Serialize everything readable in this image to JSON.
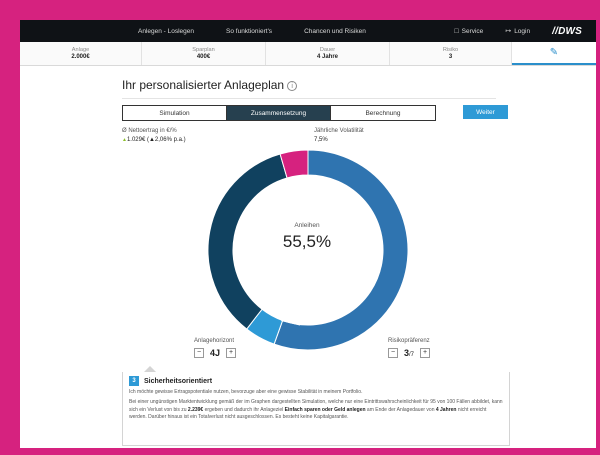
{
  "nav": {
    "items": [
      "Anlegen - Loslegen",
      "So funktioniert's",
      "Chancen und Risiken"
    ],
    "service": "Service",
    "login": "Login",
    "logo": "DWS"
  },
  "summary": [
    {
      "label": "Anlage",
      "value": "2.000€"
    },
    {
      "label": "Sparplan",
      "value": "400€"
    },
    {
      "label": "Dauer",
      "value": "4 Jahre"
    },
    {
      "label": "Risiko",
      "value": "3"
    }
  ],
  "page": {
    "title": "Ihr personalisierter Anlageplan",
    "info_glyph": "i"
  },
  "tabs": [
    {
      "label": "Simulation",
      "active": false
    },
    {
      "label": "Zusammensetzung",
      "active": true
    },
    {
      "label": "Berechnung",
      "active": false
    }
  ],
  "weiter_label": "Weiter",
  "stats": {
    "net_label": "Ø Nettoertrag in €/%",
    "net_arrow": "▲",
    "net_value": "1.029€",
    "net_pct": "(▲2,06% p.a.)",
    "vol_label": "Jährliche Volatilität",
    "vol_value": "7,5%"
  },
  "chart_data": {
    "type": "pie",
    "categories": [
      "Anleihen",
      "",
      "",
      ""
    ],
    "values": [
      55.5,
      5.0,
      35.0,
      4.5
    ],
    "colors": [
      "#2f74b0",
      "#2e9ad6",
      "#10415f",
      "#d6227f"
    ],
    "highlight": {
      "name": "Anleihen",
      "value": "55,5%"
    }
  },
  "controls": {
    "horizon_label": "Anlagehorizont",
    "horizon_value": "4J",
    "risk_label": "Risikopräferenz",
    "risk_value": "3",
    "risk_max": "/7",
    "minus": "−",
    "plus": "+"
  },
  "info": {
    "badge": "3",
    "title": "Sicherheitsorientiert",
    "line1": "Ich möchte gewisse Ertragspotentiale nutzen, bevorzuge aber eine gewisse Stabilität in meinem Portfolio.",
    "p2_a": "Bei einer ungünstigen Marktentwicklung gemäß der im Graphen dargestellten Simulation, welche nur eine Eintrittswahrscheinlichkeit für 95 von 100 Fällen abbildet, kann sich ein Verlust von bis zu ",
    "p2_b": "2.239€",
    "p2_c": " ergeben und dadurch ihr Anlageziel ",
    "p2_d": "Einfach sparen oder Geld anlegen",
    "p2_e": " am Ende der Anlagedauer von ",
    "p2_f": "4 Jahren",
    "p2_g": " nicht erreicht werden. Darüber hinaus ist ein Totalverlust nicht ausgeschlossen. Es besteht keine Kapitalgarantie."
  }
}
